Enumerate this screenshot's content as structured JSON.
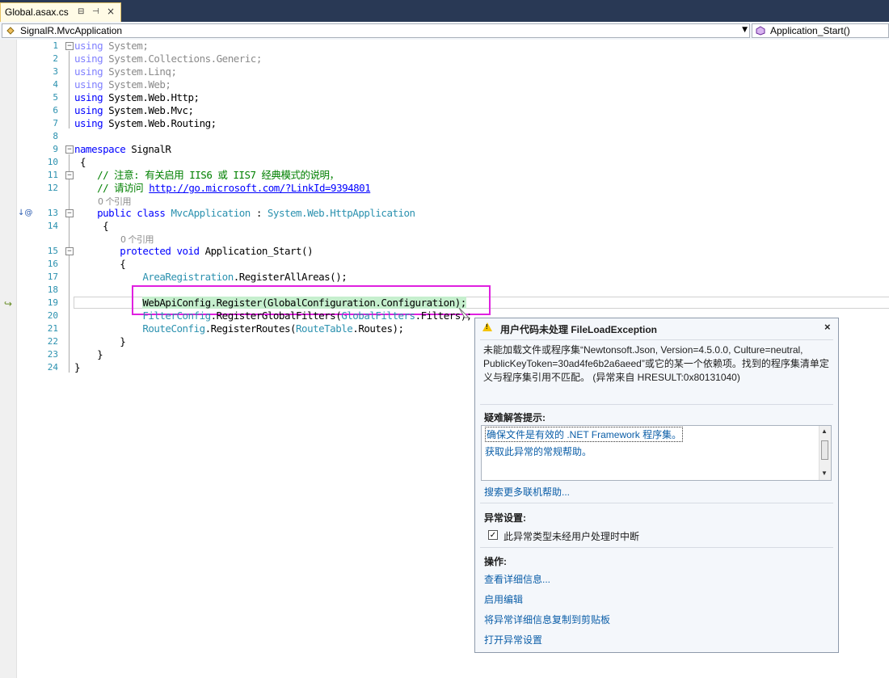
{
  "tab": {
    "title": "Global.asax.cs",
    "pin_glyph": "⊟",
    "dock_glyph": "⊣",
    "close_glyph": "×"
  },
  "navbar": {
    "left_combo": "SignalR.MvcApplication",
    "right_combo": "Application_Start()"
  },
  "editor": {
    "line_numbers": [
      "1",
      "2",
      "3",
      "4",
      "5",
      "6",
      "7",
      "8",
      "9",
      "10",
      "11",
      "12",
      "13",
      "14",
      "15",
      "16",
      "17",
      "18",
      "19",
      "20",
      "21",
      "22",
      "23",
      "24"
    ],
    "refs_label": "0 个引用",
    "code": {
      "l1_kw": "using",
      "l1_ns": " System;",
      "l2_kw": "using",
      "l2_ns": " System.Collections.Generic;",
      "l3_kw": "using",
      "l3_ns": " System.Linq;",
      "l4_kw": "using",
      "l4_ns": " System.Web;",
      "l5_kw": "using",
      "l5_ns": " System.Web.Http;",
      "l6_kw": "using",
      "l6_ns": " System.Web.Mvc;",
      "l7_kw": "using",
      "l7_ns": " System.Web.Routing;",
      "l9_kw": "namespace",
      "l9_rest": " SignalR",
      "l10": " {",
      "l11": "    // 注意: 有关启用 IIS6 或 IIS7 经典模式的说明，",
      "l12_pre": "    // 请访问 ",
      "l12_link": "http://go.microsoft.com/?LinkId=9394801",
      "l13_pre": "    ",
      "l13_kw1": "public",
      "l13_kw2": "class",
      "l13_type": "MvcApplication",
      "l13_colon": " : ",
      "l13_base": "System.Web.HttpApplication",
      "l14": "     {",
      "l15_pre": "        ",
      "l15_kw1": "protected",
      "l15_kw2": "void",
      "l15_rest": " Application_Start()",
      "l16": "        {",
      "l17_pre": "            ",
      "l17_type": "AreaRegistration",
      "l17_rest": ".RegisterAllAreas();",
      "l19_pre": "            ",
      "l19_code": "WebApiConfig.Register(GlobalConfiguration.Configuration);",
      "l20_pre": "            ",
      "l20_type": "FilterConfig",
      "l20_mid": ".RegisterGlobalFilters(",
      "l20_type2": "GlobalFilters",
      "l20_rest": ".Filters);",
      "l21_pre": "            ",
      "l21_type": "RouteConfig",
      "l21_mid": ".RegisterRoutes(",
      "l21_type2": "RouteTable",
      "l21_rest": ".Routes);",
      "l22": "        }",
      "l23": "    }",
      "l24": "}"
    }
  },
  "exception_popup": {
    "title": "用户代码未处理 FileLoadException",
    "close_glyph": "×",
    "message": "未能加载文件或程序集“Newtonsoft.Json, Version=4.5.0.0, Culture=neutral, PublicKeyToken=30ad4fe6b2a6aeed”或它的某一个依赖项。找到的程序集清单定义与程序集引用不匹配。 (异常来自 HRESULT:0x80131040)",
    "troubleshooting_title": "疑难解答提示:",
    "tips": [
      "确保文件是有效的 .NET Framework 程序集。",
      "获取此异常的常规帮助。"
    ],
    "search_online": "搜索更多联机帮助...",
    "settings_title": "异常设置:",
    "checkbox_label": "此异常类型未经用户处理时中断",
    "checkbox_checked": true,
    "actions_title": "操作:",
    "actions": [
      "查看详细信息...",
      "启用编辑",
      "将异常详细信息复制到剪贴板",
      "打开异常设置"
    ]
  },
  "colors": {
    "tab_strip": "#293955",
    "highlight_box": "#e020e0",
    "keyword": "#0000ff",
    "type": "#2b91af",
    "comment": "#008000"
  }
}
